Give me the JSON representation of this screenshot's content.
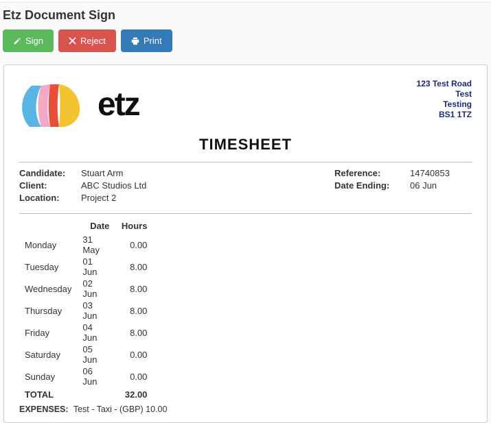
{
  "page": {
    "title": "Etz Document Sign"
  },
  "buttons": {
    "sign": "Sign",
    "reject": "Reject",
    "print": "Print"
  },
  "company": {
    "logo_text": "etz",
    "address": [
      "123 Test Road",
      "Test",
      "Testing",
      "BS1 1TZ"
    ]
  },
  "doc": {
    "title": "TIMESHEET",
    "candidate_label": "Candidate:",
    "candidate": "Stuart Arm",
    "client_label": "Client:",
    "client": "ABC Studios Ltd",
    "location_label": "Location:",
    "location": "Project 2",
    "reference_label": "Reference:",
    "reference": "14740853",
    "date_ending_label": "Date Ending:",
    "date_ending": "06 Jun"
  },
  "hours": {
    "date_header": "Date",
    "hours_header": "Hours",
    "rows": [
      {
        "day": "Monday",
        "date": "31 May",
        "hours": "0.00"
      },
      {
        "day": "Tuesday",
        "date": "01 Jun",
        "hours": "8.00"
      },
      {
        "day": "Wednesday",
        "date": "02 Jun",
        "hours": "8.00"
      },
      {
        "day": "Thursday",
        "date": "03 Jun",
        "hours": "8.00"
      },
      {
        "day": "Friday",
        "date": "04 Jun",
        "hours": "8.00"
      },
      {
        "day": "Saturday",
        "date": "05 Jun",
        "hours": "0.00"
      },
      {
        "day": "Sunday",
        "date": "06 Jun",
        "hours": "0.00"
      }
    ],
    "total_label": "TOTAL",
    "total_hours": "32.00"
  },
  "expenses": {
    "label": "EXPENSES:",
    "text": "Test - Taxi - (GBP) 10.00"
  }
}
